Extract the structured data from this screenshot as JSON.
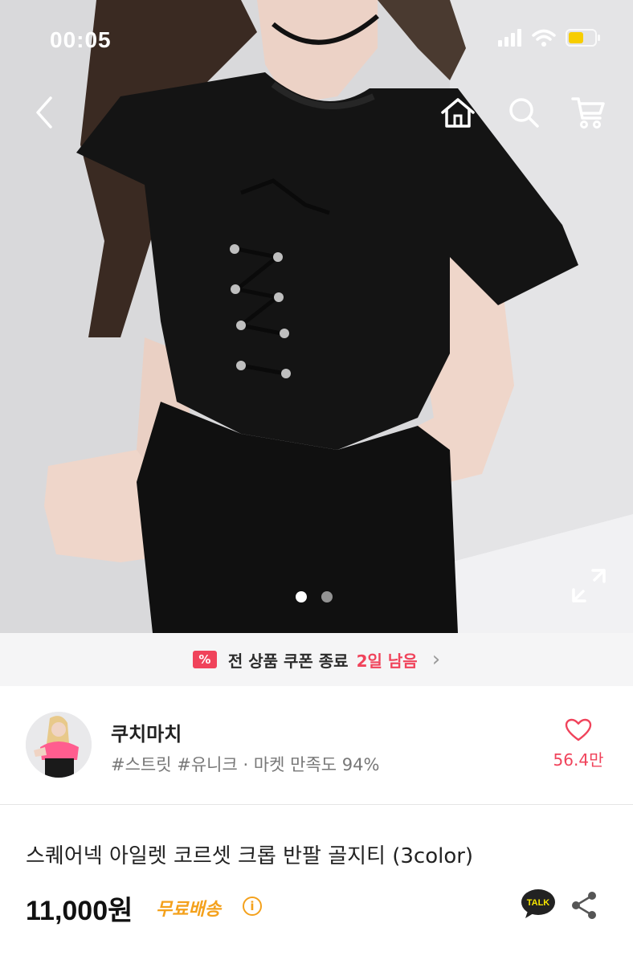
{
  "status": {
    "time": "00:05",
    "icons": [
      "signal-icon",
      "wifi-icon",
      "battery-icon"
    ]
  },
  "nav": {
    "icons": [
      "back-icon",
      "home-icon",
      "search-icon",
      "cart-icon"
    ]
  },
  "carousel": {
    "total": 2,
    "active_index": 1
  },
  "coupon": {
    "text": "전 상품 쿠폰 종료",
    "days_left": "2일 남음",
    "icon": "coupon-icon"
  },
  "shop": {
    "name": "쿠치마치",
    "tags": "#스트릿 #유니크 · 마켓 만족도 94%",
    "likes": "56.4만"
  },
  "product": {
    "title": "스퀘어넥 아일렛 코르셋 크롭 반팔 골지티 (3color)",
    "price": "11,000원",
    "shipping": "무료배송",
    "talk_label": "TALK"
  },
  "colors": {
    "accent": "#f0435b",
    "shipping": "#f4a11c"
  }
}
